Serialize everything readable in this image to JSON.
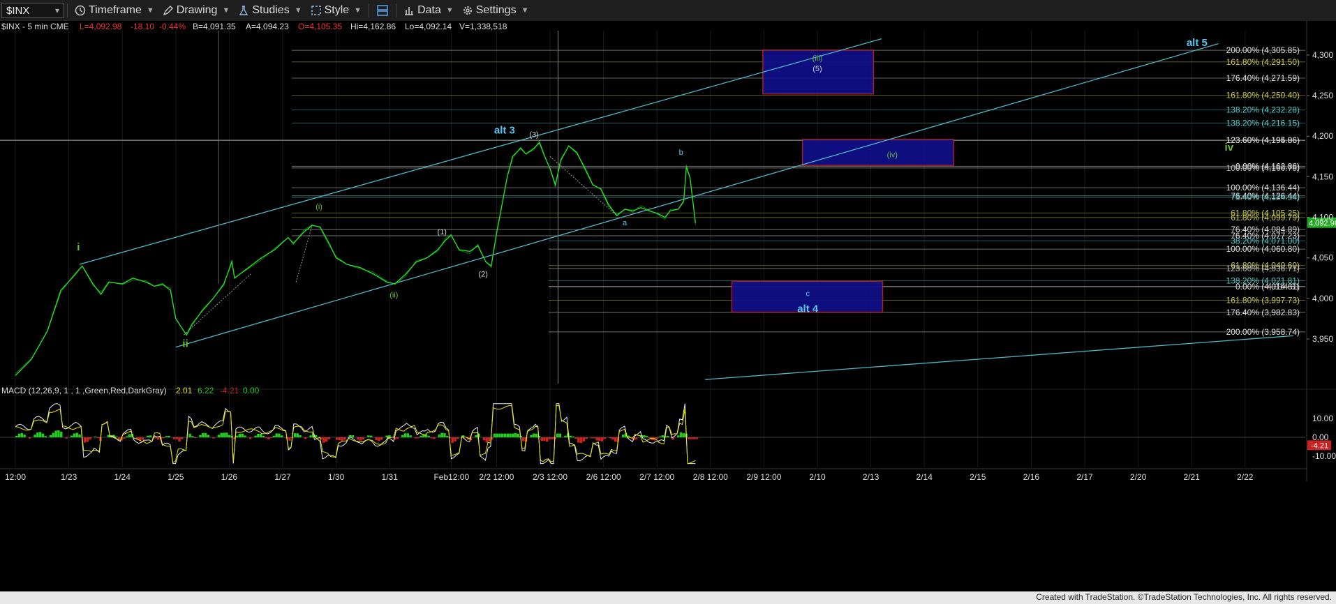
{
  "toolbar": {
    "symbol": "$INX",
    "symbol_caret": "▾",
    "timeframe": "Timeframe",
    "drawing": "Drawing",
    "studies": "Studies",
    "style": "Style",
    "data": "Data",
    "settings": "Settings"
  },
  "header": {
    "symbol_info": "$INX - 5 min  CME",
    "last": "L=4,092.98",
    "change": "-18.10",
    "change_pct": "-0.44%",
    "bid": "B=4,091.35",
    "ask": "A=4,094.23",
    "open": "O=4,105.35",
    "high": "Hi=4,162.86",
    "low": "Lo=4,092.14",
    "volume": "V=1,338,518"
  },
  "macd_header": {
    "name": "MACD (12,26,9, 1 , 1 ,Green,Red,DarkGray)",
    "v1": "2.01",
    "v2": "6.22",
    "v3": "-4.21",
    "v4": "0.00"
  },
  "footer": {
    "credit": "Created with TradeStation. ©TradeStation Technologies, Inc. All rights reserved."
  },
  "colors": {
    "price": "#22dd22",
    "channel": "#4fb8c8",
    "box_fill": "#10108a",
    "box_border": "#bb2222",
    "label_green": "#66c233",
    "label_cyan": "#55c8ee",
    "macd_a": "#eeeeee",
    "macd_b": "#e6e600",
    "hist_pos": "#22cc22",
    "hist_neg": "#cc2222"
  },
  "chart_data": {
    "type": "line",
    "title": "$INX - 5 min",
    "ylim": [
      3895,
      4330
    ],
    "y_ticks": [
      3950,
      4000,
      4050,
      4100,
      4150,
      4200,
      4250,
      4300
    ],
    "y_tick_labels": [
      "3,950",
      "4,000",
      "4,050",
      "4,100",
      "4,150",
      "4,200",
      "4,250",
      "4,300"
    ],
    "x_tick_labels": [
      "12:00",
      "1/23",
      "1/24",
      "1/25",
      "1/26",
      "1/27",
      "1/30",
      "1/31",
      "Feb12:00",
      "2/2 12:00",
      "2/3 12:00",
      "2/6 12:00",
      "2/7 12:00",
      "2/8 12:00",
      "2/9 12:00",
      "2/10",
      "2/13",
      "2/14",
      "2/15",
      "2/16",
      "2/17",
      "2/20",
      "2/21",
      "2/22"
    ],
    "x_tick_positions": [
      0,
      1,
      2,
      3,
      4,
      5,
      6,
      7,
      8,
      9,
      10,
      11,
      12,
      13,
      14,
      15,
      16,
      17,
      18,
      19,
      20,
      21,
      22,
      23
    ],
    "last_price": "4,092.98",
    "price_series": [
      [
        0.0,
        3905
      ],
      [
        0.3,
        3925
      ],
      [
        0.6,
        3960
      ],
      [
        0.85,
        4010
      ],
      [
        1.1,
        4028
      ],
      [
        1.25,
        4040
      ],
      [
        1.45,
        4018
      ],
      [
        1.6,
        4005
      ],
      [
        1.75,
        4020
      ],
      [
        2.0,
        4018
      ],
      [
        2.2,
        4025
      ],
      [
        2.45,
        4020
      ],
      [
        2.6,
        4015
      ],
      [
        2.75,
        4018
      ],
      [
        2.9,
        4010
      ],
      [
        3.0,
        3975
      ],
      [
        3.2,
        3955
      ],
      [
        3.3,
        3968
      ],
      [
        3.5,
        3985
      ],
      [
        3.7,
        4000
      ],
      [
        3.9,
        4018
      ],
      [
        4.05,
        4045
      ],
      [
        4.1,
        4025
      ],
      [
        4.3,
        4035
      ],
      [
        4.6,
        4050
      ],
      [
        4.85,
        4060
      ],
      [
        5.1,
        4075
      ],
      [
        5.2,
        4068
      ],
      [
        5.4,
        4082
      ],
      [
        5.55,
        4090
      ],
      [
        5.7,
        4088
      ],
      [
        5.85,
        4070
      ],
      [
        6.0,
        4050
      ],
      [
        6.2,
        4042
      ],
      [
        6.45,
        4038
      ],
      [
        6.7,
        4030
      ],
      [
        6.95,
        4020
      ],
      [
        7.1,
        4018
      ],
      [
        7.3,
        4030
      ],
      [
        7.5,
        4045
      ],
      [
        7.7,
        4050
      ],
      [
        7.9,
        4060
      ],
      [
        8.05,
        4072
      ],
      [
        8.15,
        4078
      ],
      [
        8.3,
        4060
      ],
      [
        8.5,
        4058
      ],
      [
        8.65,
        4065
      ],
      [
        8.8,
        4045
      ],
      [
        8.9,
        4040
      ],
      [
        9.0,
        4080
      ],
      [
        9.1,
        4115
      ],
      [
        9.2,
        4150
      ],
      [
        9.3,
        4175
      ],
      [
        9.45,
        4185
      ],
      [
        9.55,
        4178
      ],
      [
        9.7,
        4185
      ],
      [
        9.8,
        4192
      ],
      [
        9.9,
        4175
      ],
      [
        10.0,
        4160
      ],
      [
        10.1,
        4140
      ],
      [
        10.2,
        4170
      ],
      [
        10.35,
        4188
      ],
      [
        10.5,
        4180
      ],
      [
        10.65,
        4160
      ],
      [
        10.8,
        4140
      ],
      [
        10.95,
        4135
      ],
      [
        11.1,
        4115
      ],
      [
        11.25,
        4102
      ],
      [
        11.4,
        4110
      ],
      [
        11.55,
        4108
      ],
      [
        11.7,
        4112
      ],
      [
        11.85,
        4108
      ],
      [
        12.0,
        4105
      ],
      [
        12.15,
        4100
      ],
      [
        12.25,
        4108
      ],
      [
        12.4,
        4110
      ],
      [
        12.5,
        4120
      ],
      [
        12.55,
        4162
      ],
      [
        12.62,
        4148
      ],
      [
        12.68,
        4115
      ],
      [
        12.72,
        4093
      ]
    ],
    "fib_levels": [
      {
        "label": "200.00% (4,305.85)",
        "y": 4305.85
      },
      {
        "label": "161.80% (4,291.50)",
        "y": 4291.5
      },
      {
        "label": "176.40% (4,271.59)",
        "y": 4271.59
      },
      {
        "label": "161.80% (4,250.40)",
        "y": 4250.4
      },
      {
        "label": "138.20% (4,232.28)",
        "y": 4232.28
      },
      {
        "label": "138.20% (4,216.15)",
        "y": 4216.15
      },
      {
        "label": "123.60% (4,195.06)",
        "y": 4195.06
      },
      {
        "label": "123.60% (4,194.86)",
        "y": 4194.86
      },
      {
        "label": "0.00% (4,162.86)",
        "y": 4162.86
      },
      {
        "label": "100.00% (4,160.76)",
        "y": 4160.76
      },
      {
        "label": "100.00% (4,136.44)",
        "y": 4136.44
      },
      {
        "label": "76.40% (4,126.44)",
        "y": 4126.44
      },
      {
        "label": "76.40% (4,124.34)",
        "y": 4124.34
      },
      {
        "label": "61.80% (4,105.25)",
        "y": 4105.25
      },
      {
        "label": "61.80% (4,099.79)",
        "y": 4099.79
      },
      {
        "label": "76.40% (4,084.89)",
        "y": 4084.89
      },
      {
        "label": "76.40% (4,077.23)",
        "y": 4077.23
      },
      {
        "label": "38.20% (4,071.00)",
        "y": 4071.0
      },
      {
        "label": "100.00% (4,060.80)",
        "y": 4060.8
      },
      {
        "label": "61.80% (4,040.60)",
        "y": 4040.6
      },
      {
        "label": "123.60% (4,036.71)",
        "y": 4036.71
      },
      {
        "label": "138.20% (4,021.81)",
        "y": 4021.81
      },
      {
        "label": "0.00% (4,014.61)",
        "y": 4014.61
      },
      {
        "label": "4,014.61",
        "y": 4014.61
      },
      {
        "label": "161.80% (3,997.73)",
        "y": 3997.73
      },
      {
        "label": "176.40% (3,982.83)",
        "y": 3982.83
      },
      {
        "label": "200.00% (3,958.74)",
        "y": 3958.74
      }
    ],
    "wave_labels": [
      {
        "text": "i",
        "x": 1.18,
        "y": 4059,
        "color": "green"
      },
      {
        "text": "ii",
        "x": 3.18,
        "y": 3940,
        "color": "green"
      },
      {
        "text": "(i)",
        "x": 5.68,
        "y": 4110,
        "color": "green"
      },
      {
        "text": "(ii)",
        "x": 7.08,
        "y": 4001,
        "color": "green"
      },
      {
        "text": "(1)",
        "x": 7.98,
        "y": 4079,
        "color": "white"
      },
      {
        "text": "(2)",
        "x": 8.75,
        "y": 4027,
        "color": "white"
      },
      {
        "text": "alt 3",
        "x": 9.15,
        "y": 4203,
        "color": "cyan"
      },
      {
        "text": "(3)",
        "x": 9.7,
        "y": 4199,
        "color": "white"
      },
      {
        "text": "a",
        "x": 11.4,
        "y": 4090,
        "color": "cyan"
      },
      {
        "text": "b",
        "x": 12.45,
        "y": 4177,
        "color": "cyan"
      },
      {
        "text": "(iii)",
        "x": 15.0,
        "y": 4293,
        "color": "green"
      },
      {
        "text": "(5)",
        "x": 15.0,
        "y": 4280,
        "color": "white"
      },
      {
        "text": "(iv)",
        "x": 16.4,
        "y": 4174,
        "color": "green"
      },
      {
        "text": "c",
        "x": 14.82,
        "y": 4003,
        "color": "cyan"
      },
      {
        "text": "alt 4",
        "x": 14.82,
        "y": 3983,
        "color": "cyan"
      },
      {
        "text": "alt 5",
        "x": 22.1,
        "y": 4311,
        "color": "cyan"
      },
      {
        "text": "iv",
        "x": 22.7,
        "y": 4182,
        "color": "green"
      }
    ],
    "boxes": [
      {
        "name": "box-iii",
        "x0": 13.98,
        "x1": 16.05,
        "y0": 4252,
        "y1": 4306
      },
      {
        "name": "box-iv",
        "x0": 14.72,
        "x1": 17.55,
        "y0": 4164,
        "y1": 4196
      },
      {
        "name": "box-alt4",
        "x0": 13.4,
        "x1": 16.22,
        "y0": 3983,
        "y1": 4021
      }
    ],
    "channel_lines": [
      {
        "x0": 1.2,
        "y0": 4042,
        "x1": 16.2,
        "y1": 4320
      },
      {
        "x0": 3.0,
        "y0": 3940,
        "x1": 22.5,
        "y1": 4314
      },
      {
        "x0": 12.9,
        "y0": 3900,
        "x1": 23.9,
        "y1": 3954
      }
    ],
    "macd": {
      "ylim": [
        -16,
        22
      ],
      "y_ticks": [
        10,
        0,
        -10
      ],
      "y_tick_labels": [
        "10.00",
        "0.00",
        "-10.00"
      ],
      "last_label": "-4.21"
    }
  }
}
